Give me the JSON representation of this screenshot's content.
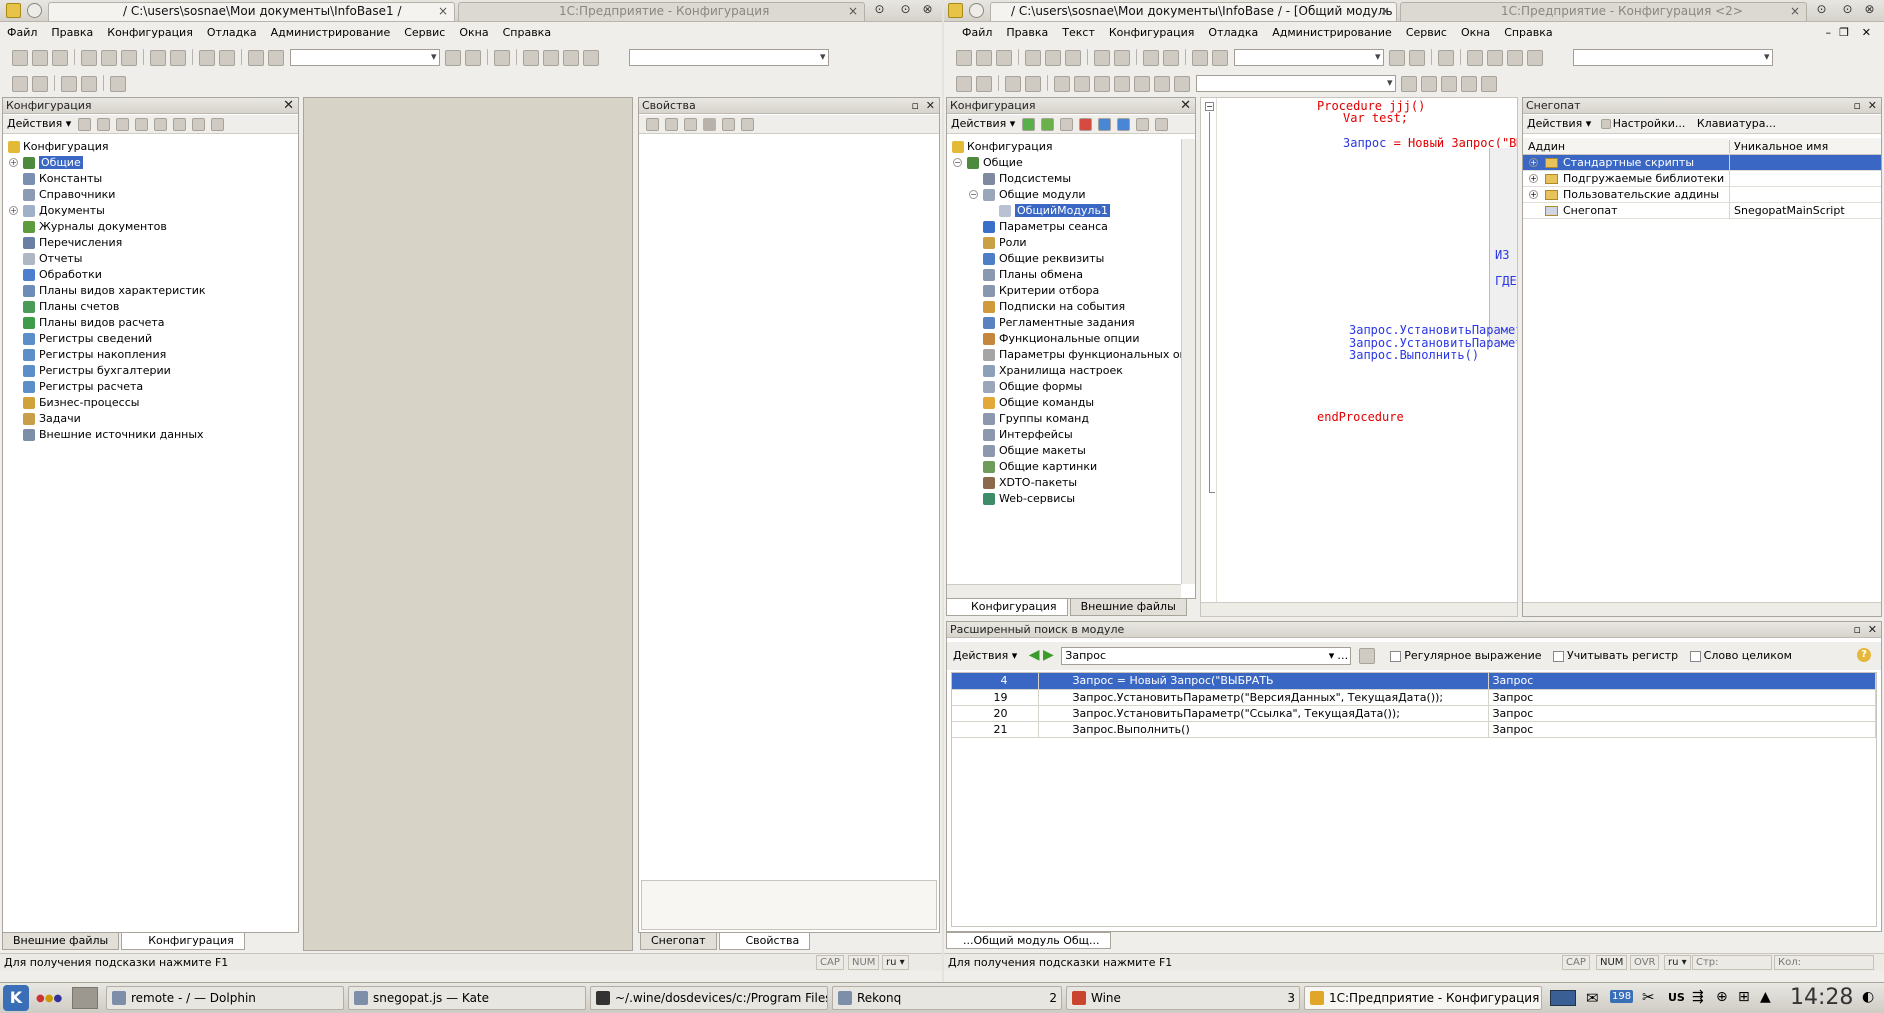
{
  "left_window": {
    "title_active": "/ C:\\users\\sosnae\\Мои документы\\InfoBase1 /",
    "title_inactive": "1С:Предприятие - Конфигурация",
    "menu": [
      "Файл",
      "Правка",
      "Конфигурация",
      "Отладка",
      "Администрирование",
      "Сервис",
      "Окна",
      "Справка"
    ],
    "config_panel": {
      "title": "Конфигурация",
      "actions": "Действия ▾",
      "items": [
        {
          "label": "Конфигурация",
          "level": 0,
          "icon": "config-icon",
          "color": "#e4b938"
        },
        {
          "label": "Общие",
          "level": 1,
          "icon": "common-icon",
          "color": "#4d8a3c",
          "expand": "+",
          "selected": true
        },
        {
          "label": "Константы",
          "level": 1,
          "icon": "constants-icon",
          "color": "#7b8fb0"
        },
        {
          "label": "Справочники",
          "level": 1,
          "icon": "catalogs-icon",
          "color": "#8c9bb3"
        },
        {
          "label": "Документы",
          "level": 1,
          "icon": "documents-icon",
          "color": "#9fb0c8",
          "expand": "+"
        },
        {
          "label": "Журналы документов",
          "level": 1,
          "icon": "journals-icon",
          "color": "#5e9a3e"
        },
        {
          "label": "Перечисления",
          "level": 1,
          "icon": "enums-icon",
          "color": "#6a7fa3"
        },
        {
          "label": "Отчеты",
          "level": 1,
          "icon": "reports-icon",
          "color": "#b0b7c4"
        },
        {
          "label": "Обработки",
          "level": 1,
          "icon": "dataprocessors-icon",
          "color": "#4e7fcf"
        },
        {
          "label": "Планы видов характеристик",
          "level": 1,
          "icon": "chartofchar-icon",
          "color": "#6e8cb8"
        },
        {
          "label": "Планы счетов",
          "level": 1,
          "icon": "chartofaccounts-icon",
          "color": "#4a9a58"
        },
        {
          "label": "Планы видов расчета",
          "level": 1,
          "icon": "chartofcalc-icon",
          "color": "#3f9d4a"
        },
        {
          "label": "Регистры сведений",
          "level": 1,
          "icon": "inforeg-icon",
          "color": "#5c8ec8"
        },
        {
          "label": "Регистры накопления",
          "level": 1,
          "icon": "accumreg-icon",
          "color": "#5c8ec8"
        },
        {
          "label": "Регистры бухгалтерии",
          "level": 1,
          "icon": "accountreg-icon",
          "color": "#5c8ec8"
        },
        {
          "label": "Регистры расчета",
          "level": 1,
          "icon": "calcreg-icon",
          "color": "#5c8ec8"
        },
        {
          "label": "Бизнес-процессы",
          "level": 1,
          "icon": "bizproc-icon",
          "color": "#d0a23a"
        },
        {
          "label": "Задачи",
          "level": 1,
          "icon": "tasks-icon",
          "color": "#c89e4b"
        },
        {
          "label": "Внешние источники данных",
          "level": 1,
          "icon": "extsources-icon",
          "color": "#7c8ea8"
        }
      ],
      "tabs": [
        "Внешние файлы",
        "Конфигурация"
      ]
    },
    "props_panel": {
      "title": "Свойства",
      "tabs": [
        "Снегопат",
        "Свойства"
      ]
    },
    "status": {
      "hint": "Для получения подсказки нажмите F1",
      "cap": "CAP",
      "num": "NUM",
      "lang": "ru ▾"
    }
  },
  "right_window": {
    "title_active": "/ C:\\users\\sosnae\\Мои документы\\InfoBase / - [Общий модуль ...",
    "title_inactive": "1С:Предприятие - Конфигурация <2>",
    "menu": [
      "Файл",
      "Правка",
      "Текст",
      "Конфигурация",
      "Отладка",
      "Администрирование",
      "Сервис",
      "Окна",
      "Справка"
    ],
    "config_panel": {
      "title": "Конфигурация",
      "actions": "Действия ▾",
      "items": [
        {
          "label": "Конфигурация",
          "level": 0,
          "icon": "config-icon",
          "color": "#e4b938"
        },
        {
          "label": "Общие",
          "level": 1,
          "icon": "common-icon",
          "color": "#4d8a3c",
          "expand": "−"
        },
        {
          "label": "Подсистемы",
          "level": 2,
          "icon": "subsystems-icon",
          "color": "#7f8aa0"
        },
        {
          "label": "Общие модули",
          "level": 2,
          "icon": "modules-icon",
          "color": "#9aa6ba",
          "expand": "−"
        },
        {
          "label": "ОбщийМодуль1",
          "level": 3,
          "icon": "module-icon",
          "color": "#b8c2d2",
          "selected": true
        },
        {
          "label": "Параметры сеанса",
          "level": 2,
          "icon": "sessionparams-icon",
          "color": "#3a6fc9"
        },
        {
          "label": "Роли",
          "level": 2,
          "icon": "roles-icon",
          "color": "#c9a044"
        },
        {
          "label": "Общие реквизиты",
          "level": 2,
          "icon": "attributes-icon",
          "color": "#4d7fc7"
        },
        {
          "label": "Планы обмена",
          "level": 2,
          "icon": "exchange-icon",
          "color": "#8a98b0"
        },
        {
          "label": "Критерии отбора",
          "level": 2,
          "icon": "filter-icon",
          "color": "#8897ad"
        },
        {
          "label": "Подписки на события",
          "level": 2,
          "icon": "subscriptions-icon",
          "color": "#d09a3c"
        },
        {
          "label": "Регламентные задания",
          "level": 2,
          "icon": "scheduled-icon",
          "color": "#5b82c0"
        },
        {
          "label": "Функциональные опции",
          "level": 2,
          "icon": "funcoptions-icon",
          "color": "#c4873e"
        },
        {
          "label": "Параметры функциональных опц",
          "level": 2,
          "icon": "funcparams-icon",
          "color": "#a5a5a5"
        },
        {
          "label": "Хранилища настроек",
          "level": 2,
          "icon": "storage-icon",
          "color": "#8da0b9"
        },
        {
          "label": "Общие формы",
          "level": 2,
          "icon": "forms-icon",
          "color": "#9aa6ba"
        },
        {
          "label": "Общие команды",
          "level": 2,
          "icon": "commands-icon",
          "color": "#e2a93a"
        },
        {
          "label": "Группы команд",
          "level": 2,
          "icon": "cmdgroups-icon",
          "color": "#8c98ad"
        },
        {
          "label": "Интерфейсы",
          "level": 2,
          "icon": "interfaces-icon",
          "color": "#8c98ad"
        },
        {
          "label": "Общие макеты",
          "level": 2,
          "icon": "templates-icon",
          "color": "#8c98ad"
        },
        {
          "label": "Общие картинки",
          "level": 2,
          "icon": "pictures-icon",
          "color": "#6e9c5a"
        },
        {
          "label": "XDTO-пакеты",
          "level": 2,
          "icon": "xdto-icon",
          "color": "#8a6a4a"
        },
        {
          "label": "Web-сервисы",
          "level": 2,
          "icon": "webservices-icon",
          "color": "#3f8c6a"
        }
      ],
      "tabs": [
        "Конфигурация",
        "Внешние файлы"
      ]
    },
    "code": {
      "lines": [
        {
          "text": "Procedure jjj()",
          "cls": "kw"
        },
        {
          "text": "Var test;",
          "cls": "kw"
        },
        {
          "text": "Запрос = Новый Запрос(\"ВЫБ",
          "cls": "mix"
        },
        {
          "text": "ИЗ",
          "cls": "b"
        },
        {
          "text": "ГДЕ",
          "cls": "b"
        },
        {
          "text": "Запрос.УстановитьПараметр",
          "cls": "b"
        },
        {
          "text": "Запрос.УстановитьПараметр",
          "cls": "b"
        },
        {
          "text": "Запрос.Выполнить()",
          "cls": "b"
        },
        {
          "text": "endProcedure",
          "cls": "kw"
        }
      ]
    },
    "snegopat_panel": {
      "title": "Снегопат",
      "actions": "Действия ▾",
      "settings": "Настройки...",
      "keyboard": "Клавиатура...",
      "columns": [
        "Аддин",
        "Уникальное имя"
      ],
      "rows": [
        {
          "name": "Стандартные скрипты",
          "unique": "",
          "selected": true
        },
        {
          "name": "Подгружаемые библиотеки",
          "unique": ""
        },
        {
          "name": "Пользовательские аддины",
          "unique": ""
        },
        {
          "name": "Снегопат",
          "unique": "SnegopatMainScript"
        }
      ]
    },
    "search_panel": {
      "title": "Расширенный поиск в модуле",
      "actions": "Действия ▾",
      "query": "Запрос",
      "opt_regex": "Регулярное выражение",
      "opt_case": "Учитывать регистр",
      "opt_whole": "Слово целиком",
      "results": [
        {
          "line": "4",
          "text": "Запрос = Новый Запрос(\"ВЫБРАТЬ",
          "match": "Запрос",
          "selected": true
        },
        {
          "line": "19",
          "text": "Запрос.УстановитьПараметр(\"ВерсияДанных\", ТекущаяДата());",
          "match": "Запрос"
        },
        {
          "line": "20",
          "text": "Запрос.УстановитьПараметр(\"Ссылка\", ТекущаяДата());",
          "match": "Запрос"
        },
        {
          "line": "21",
          "text": "Запрос.Выполнить()",
          "match": "Запрос"
        }
      ]
    },
    "bottom_tab": "...Общий модуль Общ...",
    "status": {
      "hint": "Для получения подсказки нажмите F1",
      "cap": "CAP",
      "num": "NUM",
      "ovr": "OVR",
      "lang": "ru ▾",
      "line": "Стр:",
      "col": "Кол:"
    }
  },
  "taskbar": {
    "tasks": [
      {
        "label": "remote - / — Dolphin"
      },
      {
        "label": "snegopat.js — Kate"
      },
      {
        "label": "~/.wine/dosdevices/c:/Program Files/"
      },
      {
        "label": "Rekonq",
        "count": "2"
      },
      {
        "label": "Wine",
        "count": "3"
      },
      {
        "label": "1С:Предприятие - Конфигурация",
        "active": true
      }
    ],
    "tray_badge": "198",
    "lang": "US",
    "clock": "14:28"
  }
}
